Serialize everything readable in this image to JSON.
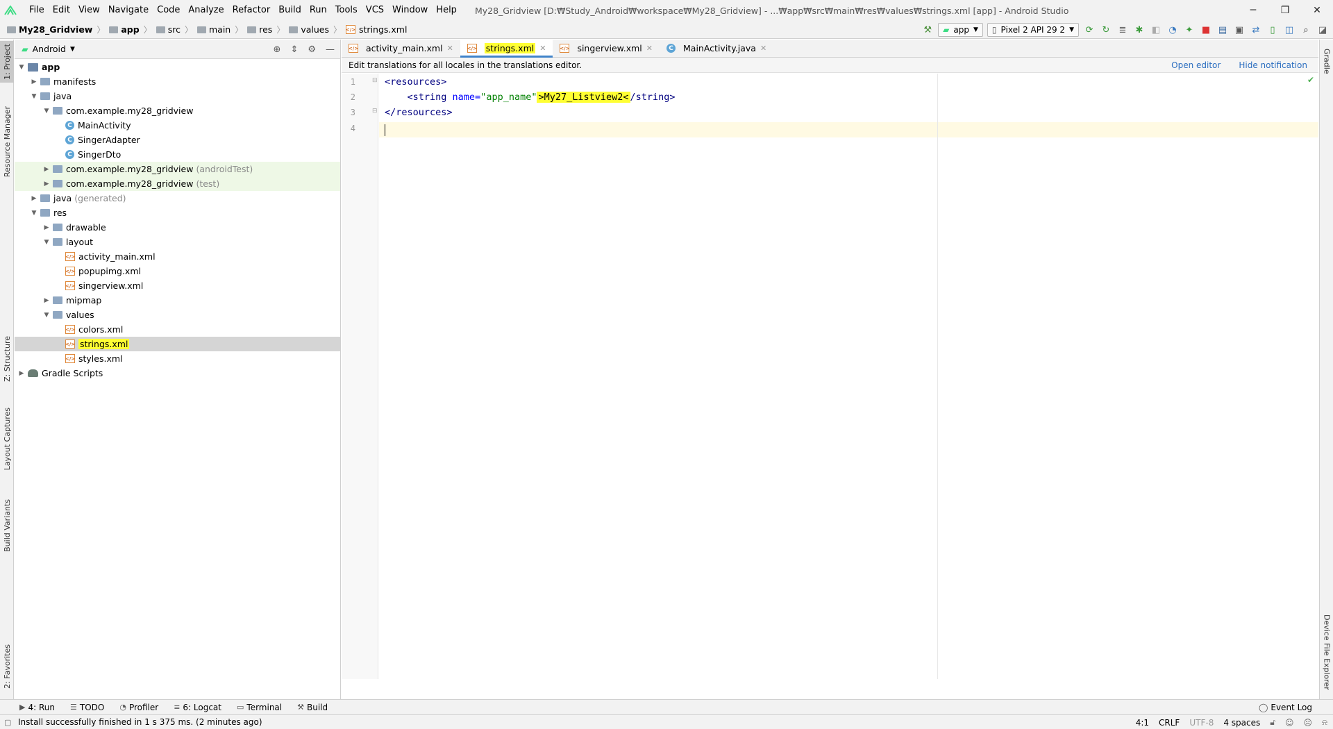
{
  "window": {
    "title": "My28_Gridview [D:₩Study_Android₩workspace₩My28_Gridview] - ...₩app₩src₩main₩res₩values₩strings.xml [app] - Android Studio",
    "minimize": "─",
    "maximize": "❐",
    "close": "✕"
  },
  "menu": [
    "File",
    "Edit",
    "View",
    "Navigate",
    "Code",
    "Analyze",
    "Refactor",
    "Build",
    "Run",
    "Tools",
    "VCS",
    "Window",
    "Help"
  ],
  "breadcrumb": [
    "My28_Gridview",
    "app",
    "src",
    "main",
    "res",
    "values",
    "strings.xml"
  ],
  "toolbar": {
    "run_config": "app",
    "device": "Pixel 2 API 29 2"
  },
  "left_tools": [
    "1: Project",
    "Resource Manager",
    "Z: Structure",
    "Layout Captures",
    "Build Variants",
    "2: Favorites"
  ],
  "right_tools": [
    "Gradle",
    "Device File Explorer"
  ],
  "project_panel": {
    "view": "Android",
    "tree": [
      {
        "label": "app",
        "suffix": "",
        "icon": "module",
        "indent": 0,
        "arrow": "▼",
        "bold": true
      },
      {
        "label": "manifests",
        "suffix": "",
        "icon": "folder",
        "indent": 1,
        "arrow": "▶"
      },
      {
        "label": "java",
        "suffix": "",
        "icon": "folder",
        "indent": 1,
        "arrow": "▼"
      },
      {
        "label": "com.example.my28_gridview",
        "suffix": "",
        "icon": "folder",
        "indent": 2,
        "arrow": "▼"
      },
      {
        "label": "MainActivity",
        "suffix": "",
        "icon": "class",
        "indent": 3,
        "arrow": ""
      },
      {
        "label": "SingerAdapter",
        "suffix": "",
        "icon": "class",
        "indent": 3,
        "arrow": ""
      },
      {
        "label": "SingerDto",
        "suffix": "",
        "icon": "class",
        "indent": 3,
        "arrow": ""
      },
      {
        "label": "com.example.my28_gridview",
        "suffix": "(androidTest)",
        "icon": "folder",
        "indent": 2,
        "arrow": "▶",
        "tint": true
      },
      {
        "label": "com.example.my28_gridview",
        "suffix": "(test)",
        "icon": "folder",
        "indent": 2,
        "arrow": "▶",
        "tint": true
      },
      {
        "label": "java",
        "suffix": "(generated)",
        "icon": "folder",
        "indent": 1,
        "arrow": "▶"
      },
      {
        "label": "res",
        "suffix": "",
        "icon": "folder",
        "indent": 1,
        "arrow": "▼"
      },
      {
        "label": "drawable",
        "suffix": "",
        "icon": "folder",
        "indent": 2,
        "arrow": "▶"
      },
      {
        "label": "layout",
        "suffix": "",
        "icon": "folder",
        "indent": 2,
        "arrow": "▼"
      },
      {
        "label": "activity_main.xml",
        "suffix": "",
        "icon": "xml",
        "indent": 3,
        "arrow": ""
      },
      {
        "label": "popupimg.xml",
        "suffix": "",
        "icon": "xml",
        "indent": 3,
        "arrow": ""
      },
      {
        "label": "singerview.xml",
        "suffix": "",
        "icon": "xml",
        "indent": 3,
        "arrow": ""
      },
      {
        "label": "mipmap",
        "suffix": "",
        "icon": "folder",
        "indent": 2,
        "arrow": "▶"
      },
      {
        "label": "values",
        "suffix": "",
        "icon": "folder",
        "indent": 2,
        "arrow": "▼"
      },
      {
        "label": "colors.xml",
        "suffix": "",
        "icon": "xml",
        "indent": 3,
        "arrow": ""
      },
      {
        "label": "strings.xml",
        "suffix": "",
        "icon": "xml",
        "indent": 3,
        "arrow": "",
        "selected": true,
        "highlight": true
      },
      {
        "label": "styles.xml",
        "suffix": "",
        "icon": "xml",
        "indent": 3,
        "arrow": ""
      },
      {
        "label": "Gradle Scripts",
        "suffix": "",
        "icon": "gradle",
        "indent": 0,
        "arrow": "▶"
      }
    ]
  },
  "editor": {
    "tabs": [
      {
        "label": "activity_main.xml",
        "icon": "xml",
        "active": false
      },
      {
        "label": "strings.xml",
        "icon": "xml",
        "active": true,
        "highlight": true
      },
      {
        "label": "singerview.xml",
        "icon": "xml",
        "active": false
      },
      {
        "label": "MainActivity.java",
        "icon": "class",
        "active": false
      }
    ],
    "notification": "Edit translations for all locales in the translations editor.",
    "open_editor": "Open editor",
    "hide_notification": "Hide notification",
    "line_numbers": [
      "1",
      "2",
      "3",
      "4"
    ],
    "code": {
      "line1": "<resources>",
      "line2_indent": "    ",
      "line2_open": "<string ",
      "line2_attr": "name=",
      "line2_val": "\"app_name\"",
      "line2_text": ">My27_Listview2<",
      "line2_close": "/string>",
      "line3": "</resources>"
    }
  },
  "bottom_tools": [
    {
      "label": "4: Run",
      "glyph": "▶"
    },
    {
      "label": "TODO",
      "glyph": "☰"
    },
    {
      "label": "Profiler",
      "glyph": "◔"
    },
    {
      "label": "6: Logcat",
      "glyph": "≡"
    },
    {
      "label": "Terminal",
      "glyph": "▭"
    },
    {
      "label": "Build",
      "glyph": "⚒"
    }
  ],
  "event_log": "Event Log",
  "status": {
    "message": "Install successfully finished in 1 s 375 ms. (2 minutes ago)",
    "position": "4:1",
    "line_sep": "CRLF",
    "encoding": "UTF-8",
    "indent": "4 spaces"
  },
  "colors": {
    "highlight": "#ffff33",
    "accent": "#4083c9",
    "tree_tint": "#eef8e6",
    "selection": "#d5d5d5"
  }
}
